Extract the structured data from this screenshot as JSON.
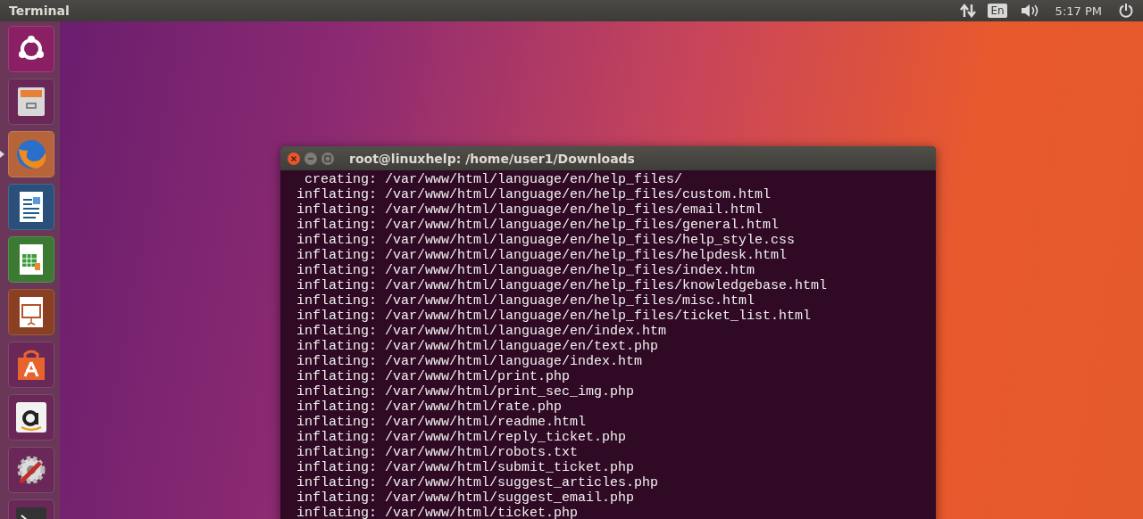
{
  "top_panel": {
    "title": "Terminal",
    "keyboard_layout": "En",
    "time": "5:17 PM"
  },
  "launcher": [
    {
      "kind": "ubuntu",
      "running": false
    },
    {
      "kind": "files",
      "running": false
    },
    {
      "kind": "firefox",
      "running": true
    },
    {
      "kind": "writer",
      "running": false
    },
    {
      "kind": "calc",
      "running": false
    },
    {
      "kind": "impress",
      "running": false
    },
    {
      "kind": "software",
      "running": false
    },
    {
      "kind": "amazon",
      "running": false
    },
    {
      "kind": "settings",
      "running": false
    },
    {
      "kind": "terminal",
      "running": false
    }
  ],
  "terminal": {
    "title": "root@linuxhelp: /home/user1/Downloads",
    "lines": [
      "   creating: /var/www/html/language/en/help_files/",
      "  inflating: /var/www/html/language/en/help_files/custom.html",
      "  inflating: /var/www/html/language/en/help_files/email.html",
      "  inflating: /var/www/html/language/en/help_files/general.html",
      "  inflating: /var/www/html/language/en/help_files/help_style.css",
      "  inflating: /var/www/html/language/en/help_files/helpdesk.html",
      "  inflating: /var/www/html/language/en/help_files/index.htm",
      "  inflating: /var/www/html/language/en/help_files/knowledgebase.html",
      "  inflating: /var/www/html/language/en/help_files/misc.html",
      "  inflating: /var/www/html/language/en/help_files/ticket_list.html",
      "  inflating: /var/www/html/language/en/index.htm",
      "  inflating: /var/www/html/language/en/text.php",
      "  inflating: /var/www/html/language/index.htm",
      "  inflating: /var/www/html/print.php",
      "  inflating: /var/www/html/print_sec_img.php",
      "  inflating: /var/www/html/rate.php",
      "  inflating: /var/www/html/readme.html",
      "  inflating: /var/www/html/reply_ticket.php",
      "  inflating: /var/www/html/robots.txt",
      "  inflating: /var/www/html/submit_ticket.php",
      "  inflating: /var/www/html/suggest_articles.php",
      "  inflating: /var/www/html/suggest_email.php",
      "  inflating: /var/www/html/ticket.php"
    ]
  }
}
